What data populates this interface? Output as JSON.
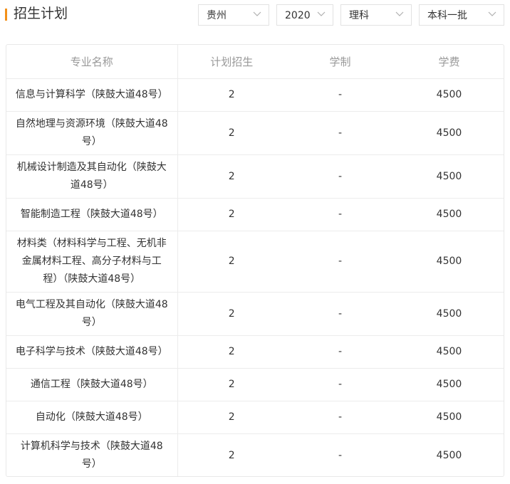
{
  "header": {
    "title": "招生计划",
    "accent_color": "#f39019"
  },
  "filters": {
    "province": "贵州",
    "year": "2020",
    "subject": "理科",
    "batch": "本科一批"
  },
  "table": {
    "columns": [
      "专业名称",
      "计划招生",
      "学制",
      "学费"
    ],
    "rows": [
      {
        "major": "信息与计算科学（陕鼓大道48号）",
        "plan": "2",
        "duration": "-",
        "fee": "4500"
      },
      {
        "major": "自然地理与资源环境（陕鼓大道48号）",
        "plan": "2",
        "duration": "-",
        "fee": "4500"
      },
      {
        "major": "机械设计制造及其自动化（陕鼓大道48号）",
        "plan": "2",
        "duration": "-",
        "fee": "4500"
      },
      {
        "major": "智能制造工程（陕鼓大道48号）",
        "plan": "2",
        "duration": "-",
        "fee": "4500"
      },
      {
        "major": "材料类（材料科学与工程、无机非金属材料工程、高分子材料与工程）（陕鼓大道48号）",
        "plan": "2",
        "duration": "-",
        "fee": "4500"
      },
      {
        "major": "电气工程及其自动化（陕鼓大道48号）",
        "plan": "2",
        "duration": "-",
        "fee": "4500"
      },
      {
        "major": "电子科学与技术（陕鼓大道48号）",
        "plan": "2",
        "duration": "-",
        "fee": "4500"
      },
      {
        "major": "通信工程（陕鼓大道48号）",
        "plan": "2",
        "duration": "-",
        "fee": "4500"
      },
      {
        "major": "自动化（陕鼓大道48号）",
        "plan": "2",
        "duration": "-",
        "fee": "4500"
      },
      {
        "major": "计算机科学与技术（陕鼓大道48号）",
        "plan": "2",
        "duration": "-",
        "fee": "4500"
      }
    ]
  }
}
